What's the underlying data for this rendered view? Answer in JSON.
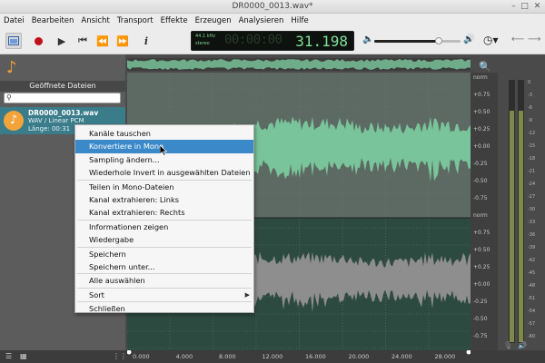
{
  "window": {
    "title": "DR0000_0013.wav*",
    "controls": [
      "–",
      "□",
      "✕"
    ]
  },
  "menu": [
    "Datei",
    "Bearbeiten",
    "Ansicht",
    "Transport",
    "Effekte",
    "Erzeugen",
    "Analysieren",
    "Hilfe"
  ],
  "toolbar": {
    "sample_rate": "44.1 kHz",
    "channels": "stereo",
    "time_display": "31.198",
    "time_ghost": "00:00:00",
    "volume_fraction": 0.75
  },
  "left_panel": {
    "header": "Geöffnete Dateien",
    "search_value": "",
    "file": {
      "name": "DR0000_0013.wav",
      "type": "WAV / Linear PCM",
      "length": "Länge: 00:31"
    }
  },
  "context_menu": {
    "items": [
      {
        "label": "Kanäle tauschen"
      },
      {
        "label": "Konvertiere in Mono",
        "highlighted": true
      },
      {
        "label": "Sampling ändern..."
      },
      {
        "label": "Wiederhole Invert in ausgewählten Dateien"
      },
      {
        "separator": true
      },
      {
        "label": "Teilen in Mono-Dateien"
      },
      {
        "label": "Kanal extrahieren: Links"
      },
      {
        "label": "Kanal extrahieren: Rechts"
      },
      {
        "separator": true
      },
      {
        "label": "Informationen zeigen"
      },
      {
        "label": "Wiedergabe"
      },
      {
        "separator": true
      },
      {
        "label": "Speichern"
      },
      {
        "label": "Speichern unter..."
      },
      {
        "separator": true
      },
      {
        "label": "Alle auswählen"
      },
      {
        "separator": true
      },
      {
        "label": "Sort",
        "submenu": true
      },
      {
        "separator": true
      },
      {
        "label": "Schließen"
      }
    ]
  },
  "time_axis": [
    "0.000",
    "4.000",
    "8.000",
    "12.000",
    "16.000",
    "20.000",
    "24.000",
    "28.000"
  ],
  "amplitude_scale": [
    "norm",
    "+0.75",
    "+0.50",
    "+0.25",
    "+0.00",
    "-0.25",
    "-0.50",
    "-0.75",
    "norm",
    "+0.75",
    "+0.50",
    "+0.25",
    "+0.00",
    "-0.25",
    "-0.50",
    "-0.75"
  ],
  "meter_scale": [
    "0",
    "-3",
    "-6",
    "-9",
    "-12",
    "-15",
    "-18",
    "-21",
    "-24",
    "-27",
    "-30",
    "-33",
    "-36",
    "-39",
    "-42",
    "-45",
    "-48",
    "-51",
    "-54",
    "-57",
    "-60"
  ],
  "colors": {
    "wave_top": "#79c49a",
    "wave_bottom": "#8a8a8a",
    "highlight": "#3b89c9",
    "file_item": "#3a7c8a",
    "lcd_text": "#7fe09a"
  }
}
